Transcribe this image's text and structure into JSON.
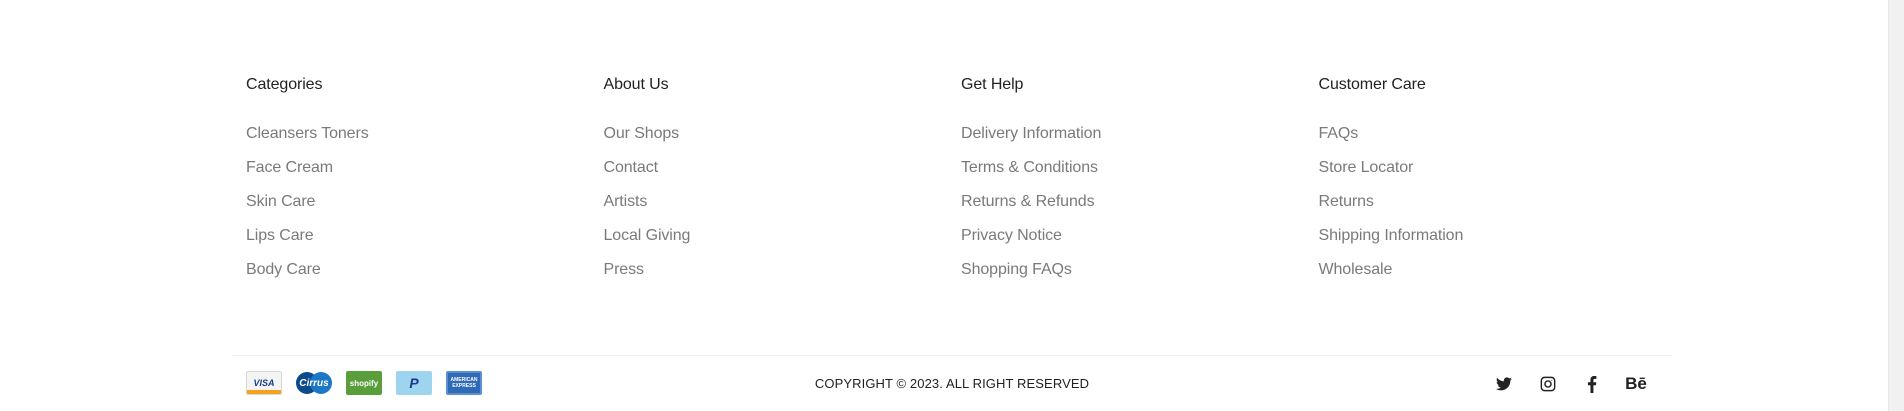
{
  "columns": [
    {
      "title": "Categories",
      "links": [
        "Cleansers Toners",
        "Face Cream",
        "Skin Care",
        "Lips Care",
        "Body Care"
      ]
    },
    {
      "title": "About Us",
      "links": [
        "Our Shops",
        "Contact",
        "Artists",
        "Local Giving",
        "Press"
      ]
    },
    {
      "title": "Get Help",
      "links": [
        "Delivery Information",
        "Terms & Conditions",
        "Returns & Refunds",
        "Privacy Notice",
        "Shopping FAQs"
      ]
    },
    {
      "title": "Customer Care",
      "links": [
        "FAQs",
        "Store Locator",
        "Returns",
        "Shipping Information",
        "Wholesale"
      ]
    }
  ],
  "payments": {
    "visa": "VISA",
    "cirrus": "Cirrus",
    "shopify": "shopify",
    "paypal": "P",
    "amex": "AMERICAN EXPRESS"
  },
  "copyright": "COPYRIGHT © 2023. ALL RIGHT RESERVED",
  "social": {
    "twitter_icon": "twitter-icon",
    "instagram_icon": "instagram-icon",
    "facebook_icon": "facebook-icon",
    "behance_label": "Bē"
  },
  "colors": {
    "heading": "#222222",
    "link": "#7a7a7a",
    "divider": "#eeeeee"
  }
}
